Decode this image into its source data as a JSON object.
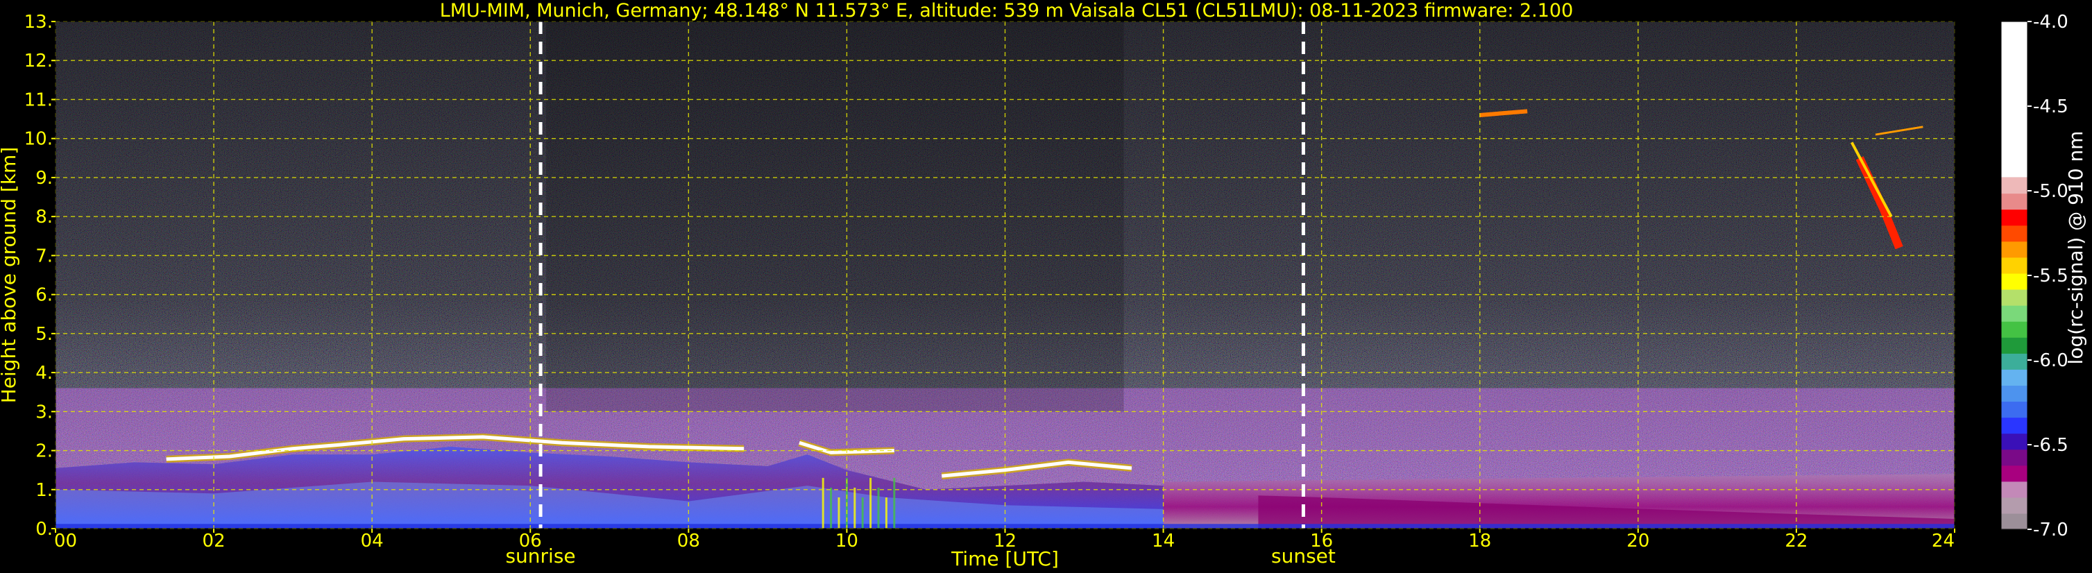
{
  "chart_data": {
    "type": "heatmap",
    "title": "LMU-MIM, Munich, Germany; 48.148° N 11.573° E, altitude: 539 m    Vaisala CL51 (CL51LMU): 08-11-2023    firmware: 2.100",
    "xlabel": "Time [UTC]",
    "ylabel": "Height above ground [km]",
    "x_ticks": [
      "00",
      "02",
      "04",
      "06",
      "08",
      "10",
      "12",
      "14",
      "16",
      "18",
      "20",
      "22",
      "24"
    ],
    "y_ticks": [
      "0.",
      "1.",
      "2.",
      "3.",
      "4.",
      "5.",
      "6.",
      "7.",
      "8.",
      "9.",
      "10.",
      "11.",
      "12.",
      "13."
    ],
    "xlim": [
      0,
      24
    ],
    "ylim": [
      0,
      13
    ],
    "grid": true,
    "colorbar": {
      "label": "log(rc-signal) @ 910 nm",
      "ticks": [
        "-4.0",
        "-4.5",
        "-5.0",
        "-5.5",
        "-6.0",
        "-6.5",
        "-7.0"
      ],
      "range": [
        -7.0,
        -4.0
      ],
      "colors": [
        "#9c8f99",
        "#b49cad",
        "#c389b8",
        "#a8007f",
        "#7a0a88",
        "#3a10b8",
        "#2a36ff",
        "#3c6cf0",
        "#4d93ee",
        "#64b3f0",
        "#3cae9a",
        "#1f9a3a",
        "#44c244",
        "#7ad97a",
        "#b4e06a",
        "#ffff00",
        "#ffd200",
        "#ff9a00",
        "#ff4a00",
        "#ff0000",
        "#e88a8a",
        "#eeb9b9",
        "#ffffff"
      ]
    },
    "markers": [
      {
        "x": 6.13,
        "label": "sunrise"
      },
      {
        "x": 15.77,
        "label": "sunset"
      }
    ],
    "features": {
      "cloud_layer_km": [
        {
          "t": 1.4,
          "h": 1.78
        },
        {
          "t": 2.2,
          "h": 1.85
        },
        {
          "t": 3.0,
          "h": 2.05
        },
        {
          "t": 3.6,
          "h": 2.15
        },
        {
          "t": 4.4,
          "h": 2.3
        },
        {
          "t": 5.4,
          "h": 2.35
        },
        {
          "t": 6.4,
          "h": 2.2
        },
        {
          "t": 7.5,
          "h": 2.1
        },
        {
          "t": 8.7,
          "h": 2.05
        },
        {
          "t": 9.4,
          "h": 2.2
        },
        {
          "t": 9.8,
          "h": 1.95
        },
        {
          "t": 10.6,
          "h": 2.0
        },
        {
          "t": 11.2,
          "h": 1.35
        },
        {
          "t": 12.0,
          "h": 1.5
        },
        {
          "t": 12.8,
          "h": 1.7
        },
        {
          "t": 13.6,
          "h": 1.55
        }
      ],
      "high_cloud_km": [
        {
          "t": 18.0,
          "h": 10.6
        },
        {
          "t": 18.6,
          "h": 10.7
        },
        {
          "t": 22.8,
          "h": 9.5
        },
        {
          "t": 23.1,
          "h": 8.2
        }
      ]
    }
  }
}
